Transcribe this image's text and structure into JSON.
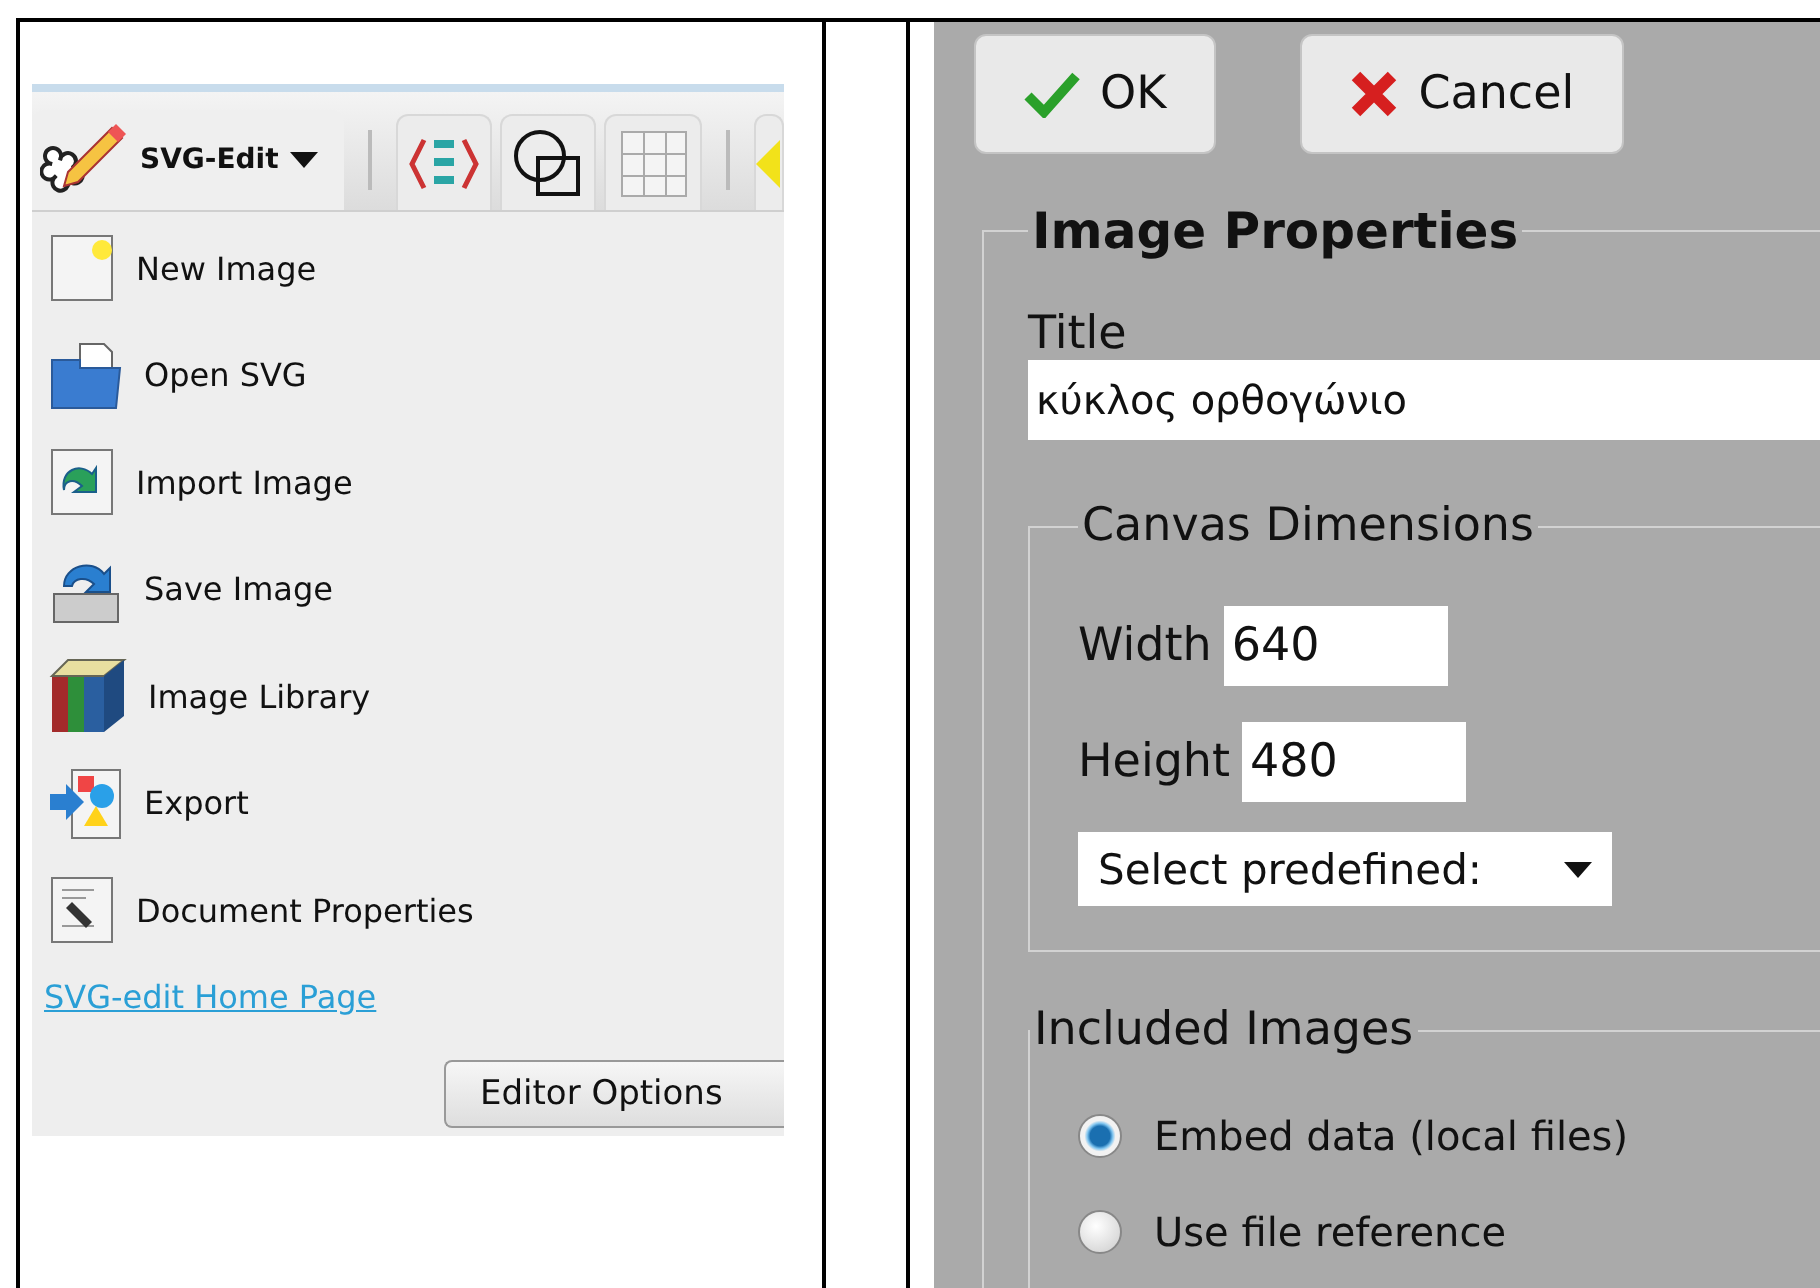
{
  "menu": {
    "title": "SVG-Edit",
    "items": [
      {
        "kind": "new",
        "label": "New Image"
      },
      {
        "kind": "open",
        "label": "Open SVG"
      },
      {
        "kind": "import",
        "label": "Import Image"
      },
      {
        "kind": "save",
        "label": "Save Image"
      },
      {
        "kind": "library",
        "label": "Image Library"
      },
      {
        "kind": "export",
        "label": "Export"
      },
      {
        "kind": "properties",
        "label": "Document Properties"
      }
    ],
    "link": "SVG-edit Home Page",
    "button": "Editor Options"
  },
  "dialog": {
    "buttons": [
      {
        "kind": "ok",
        "label": "OK"
      },
      {
        "kind": "cancel",
        "label": "Cancel"
      }
    ],
    "heading": "Image Properties",
    "title_label": "Title",
    "title_value": "κύκλος ορθογώνιο",
    "canvas": {
      "legend": "Canvas Dimensions",
      "width_label": "Width",
      "width_value": "640",
      "height_label": "Height",
      "height_value": "480",
      "select": "Select predefined:"
    },
    "images": {
      "legend": "Included Images",
      "options": [
        {
          "label": "Embed data (local files)",
          "selected": true
        },
        {
          "label": "Use file reference",
          "selected": false
        }
      ]
    }
  }
}
